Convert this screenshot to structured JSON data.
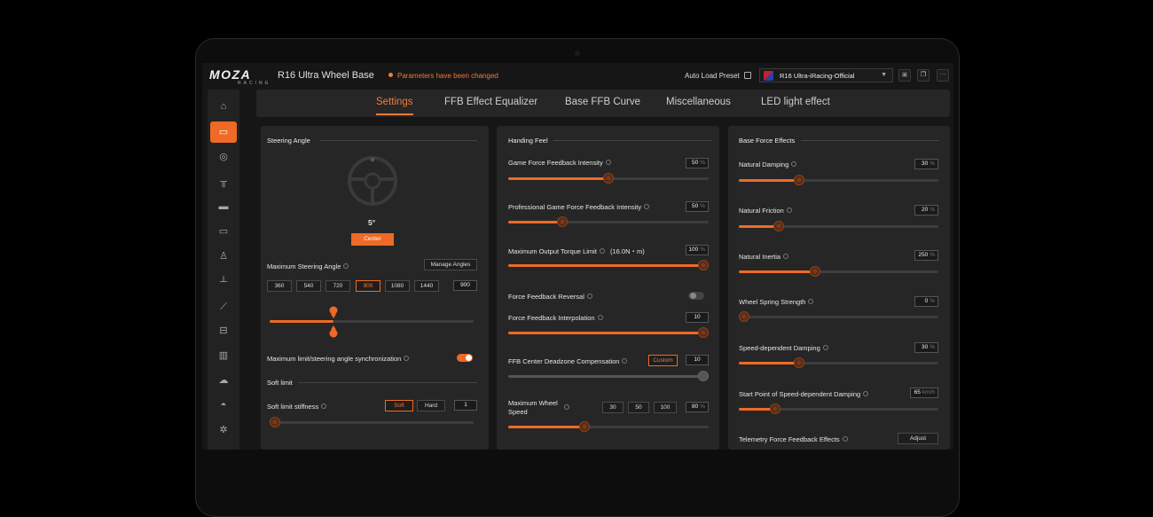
{
  "app": {
    "logo": "MOZA",
    "logo_sub": "RACING",
    "device_title": "R16 Ultra Wheel Base",
    "changed_notice": "Parameters have been changed",
    "auto_load_label": "Auto Load Preset",
    "preset_value": "R16 Ultra-iRacing-Official"
  },
  "sidebar": {
    "items": [
      {
        "name": "home-icon",
        "glyph": "⌂"
      },
      {
        "name": "wheel-base-icon",
        "glyph": "▭",
        "active": true
      },
      {
        "name": "steering-wheel-icon",
        "glyph": "◎"
      },
      {
        "name": "pedals-icon",
        "glyph": "╥"
      },
      {
        "name": "dashboard-icon",
        "glyph": "▬"
      },
      {
        "name": "button-box-icon",
        "glyph": "▭"
      },
      {
        "name": "joystick-icon",
        "glyph": "♙"
      },
      {
        "name": "shifter-icon",
        "glyph": "┴"
      },
      {
        "name": "handbrake-icon",
        "glyph": "⟋"
      },
      {
        "name": "hub-icon",
        "glyph": "⊟"
      },
      {
        "name": "library-icon",
        "glyph": "▥"
      },
      {
        "name": "cloud-upload-icon",
        "glyph": "☁"
      },
      {
        "name": "helmet-icon",
        "glyph": "◓"
      },
      {
        "name": "settings-icon",
        "glyph": "✲"
      }
    ]
  },
  "tabs": [
    "Settings",
    "FFB Effect Equalizer",
    "Base FFB Curve",
    "Miscellaneous",
    "LED light effect"
  ],
  "left": {
    "title": "Steering Angle",
    "angle_readout": "5°",
    "center_btn": "Center",
    "max_angle_label": "Maximum Steering Angle",
    "manage_btn": "Manage Angles",
    "presets": [
      "360",
      "540",
      "720",
      "900",
      "1080",
      "1440"
    ],
    "angle_value": "900",
    "sync_label": "Maximum limit/steering angle synchronization",
    "soft_limit_title": "Soft limit",
    "stiffness_label": "Soft limit stiffness",
    "soft_btn": "Soft",
    "hard_btn": "Hard",
    "stiffness_value": "1"
  },
  "middle": {
    "title": "Handing Feel",
    "game_ffb": {
      "label": "Game Force Feedback Intensity",
      "value": "50",
      "unit": "%",
      "level": 0.5
    },
    "pro_ffb": {
      "label": "Professional Game Force Feedback Intensity",
      "value": "50",
      "unit": "%",
      "level": 0.27
    },
    "torque": {
      "label": "Maximum Output Torque Limit",
      "extra": "(16.0N・m)",
      "value": "100",
      "unit": "%",
      "level": 1.0
    },
    "reversal_label": "Force Feedback Reversal",
    "interp": {
      "label": "Force Feedback Interpolation",
      "value": "10",
      "level": 1.0
    },
    "deadzone": {
      "label": "FFB Center Deadzone Compensation",
      "btn": "Custom",
      "value": "10",
      "level": 1.0
    },
    "wheel_speed": {
      "label": "Maximum Wheel Speed",
      "presets": [
        "30",
        "50",
        "100"
      ],
      "value": "80",
      "unit": "%",
      "level": 0.38
    }
  },
  "right": {
    "title": "Base Force Effects",
    "damping": {
      "label": "Natural Damping",
      "value": "30",
      "unit": "%",
      "level": 0.3
    },
    "friction": {
      "label": "Natural Friction",
      "value": "20",
      "unit": "%",
      "level": 0.2
    },
    "inertia": {
      "label": "Natural Inertia",
      "value": "250",
      "unit": "%",
      "level": 0.38
    },
    "spring": {
      "label": "Wheel Spring Strength",
      "value": "0",
      "unit": "%",
      "level": 0.0
    },
    "speed_damping": {
      "label": "Speed-dependent Damping",
      "value": "30",
      "unit": "%",
      "level": 0.3
    },
    "speed_start": {
      "label": "Start Point of Speed-dependent Damping",
      "value": "65",
      "unit": "km/h",
      "level": 0.18
    },
    "telemetry_label": "Telemetry Force Feedback Effects",
    "adjust_btn": "Adjust"
  }
}
